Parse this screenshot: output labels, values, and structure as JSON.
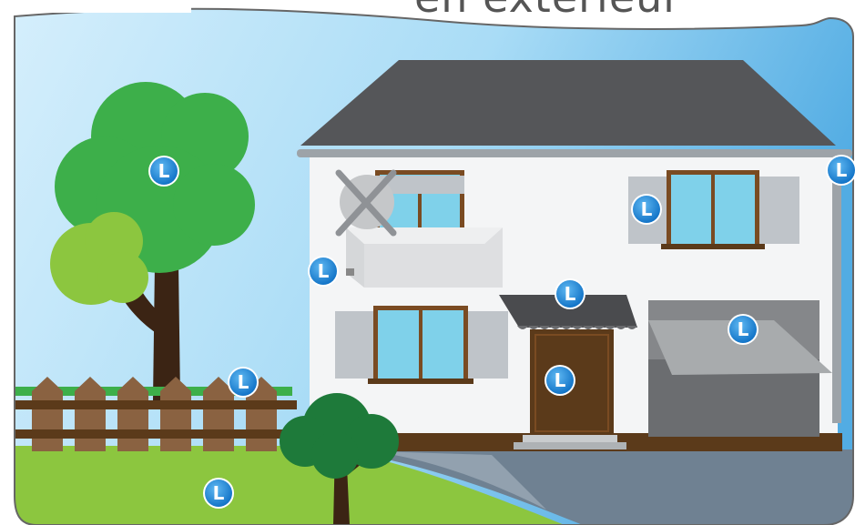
{
  "title": "en extérieur",
  "hotspot_glyph": "L",
  "colors": {
    "sky_top": "#bfe6fb",
    "sky_bottom": "#5fb6e8",
    "lawn": "#8cc63f",
    "road": "#6f8192",
    "roof": "#555659",
    "wall": "#f4f5f6",
    "door": "#5b3a1a",
    "window": "#7fd1ea",
    "shutter": "#bfc4c9",
    "tree": "#3daf4a",
    "fence": "#8a6241",
    "hotspot": "#1e88d8"
  },
  "hotspots": [
    {
      "name": "hotspot-tree",
      "label": "tree"
    },
    {
      "name": "hotspot-fence",
      "label": "fence"
    },
    {
      "name": "hotspot-lawn",
      "label": "lawn"
    },
    {
      "name": "hotspot-outdoor-light",
      "label": "outdoor light"
    },
    {
      "name": "hotspot-shutters",
      "label": "shutters"
    },
    {
      "name": "hotspot-door-canopy",
      "label": "door canopy"
    },
    {
      "name": "hotspot-door",
      "label": "door"
    },
    {
      "name": "hotspot-garage-door",
      "label": "garage door"
    },
    {
      "name": "hotspot-gutter",
      "label": "gutter"
    }
  ]
}
